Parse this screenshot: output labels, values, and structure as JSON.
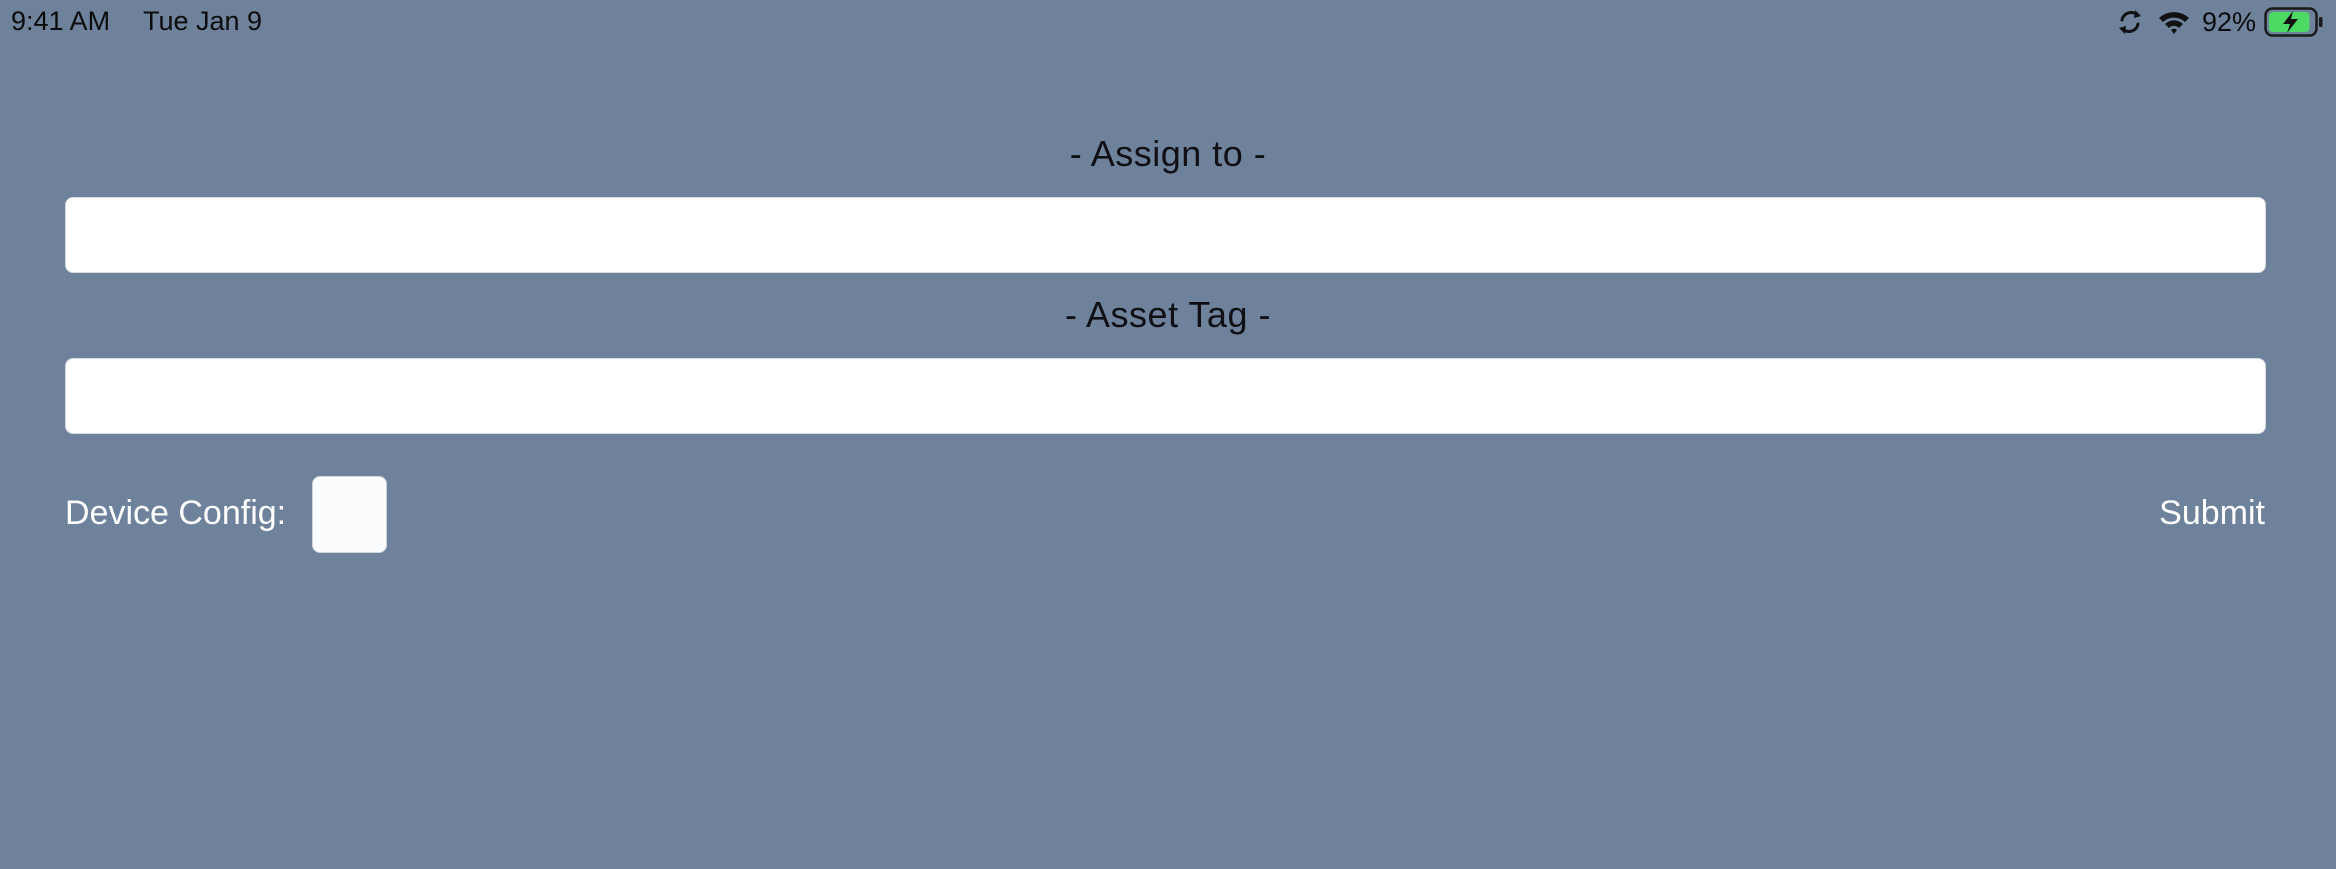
{
  "status_bar": {
    "time": "9:41 AM",
    "date": "Tue Jan 9",
    "battery_percent": "92%",
    "icons": [
      "sync-icon",
      "wifi-icon",
      "battery-charging-icon"
    ],
    "battery_level": 0.92,
    "battery_color": "#4cd964"
  },
  "form": {
    "assign_label": "- Assign to -",
    "assign_value": "",
    "asset_label": "- Asset Tag -",
    "asset_value": "",
    "device_config_label": "Device Config:",
    "device_config_checked": false,
    "submit_label": "Submit"
  },
  "colors": {
    "background": "#6e829c",
    "field_background": "#ffffff",
    "accent_text": "#ffffff"
  }
}
